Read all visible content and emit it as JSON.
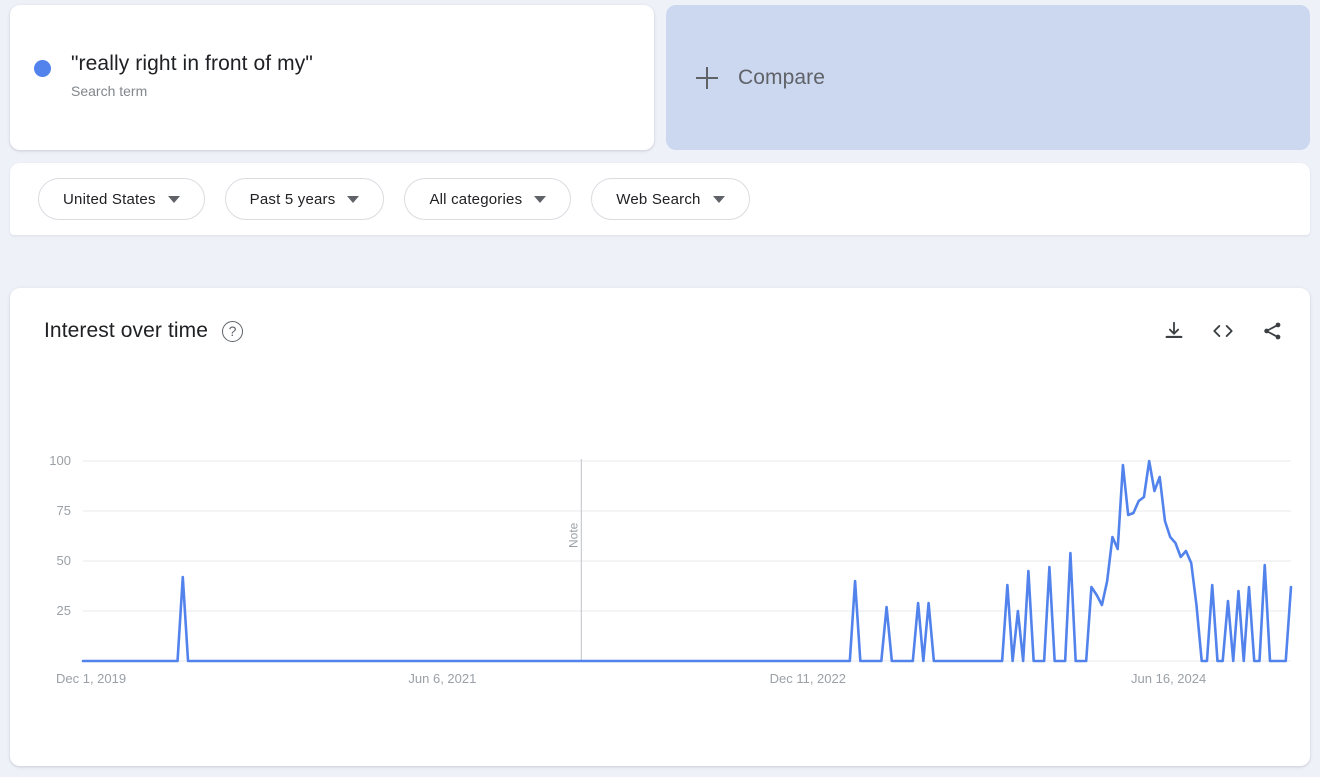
{
  "search_term": {
    "title": "\"really right in front of my\"",
    "subtitle": "Search term",
    "dot_color": "#5283ec"
  },
  "compare": {
    "label": "Compare",
    "icon": "plus-icon"
  },
  "filters": [
    {
      "label": "United States",
      "name": "location"
    },
    {
      "label": "Past 5 years",
      "name": "time-range"
    },
    {
      "label": "All categories",
      "name": "category"
    },
    {
      "label": "Web Search",
      "name": "search-type"
    }
  ],
  "chart_card": {
    "title": "Interest over time",
    "help_icon": "?",
    "actions": [
      {
        "name": "download-csv-icon",
        "label": "Download"
      },
      {
        "name": "embed-code-icon",
        "label": "Embed"
      },
      {
        "name": "share-icon",
        "label": "Share"
      }
    ]
  },
  "chart_data": {
    "type": "line",
    "title": "Interest over time",
    "xlabel": "",
    "ylabel": "",
    "ylim": [
      0,
      100
    ],
    "yticks": [
      100,
      75,
      50,
      25
    ],
    "xticks": [
      "Dec 1, 2019",
      "Jun 6, 2021",
      "Dec 11, 2022",
      "Jun 16, 2024"
    ],
    "xtick_positions": [
      0,
      0.2975,
      0.6,
      0.8987
    ],
    "grid": true,
    "legend": "hidden",
    "series_color": "#5283ec",
    "annotations": [
      {
        "label": "Note",
        "x_fraction": 0.4125,
        "orientation": "vertical"
      }
    ],
    "series": [
      {
        "name": "\"really right in front of my\"",
        "values": [
          0,
          0,
          0,
          0,
          0,
          0,
          0,
          0,
          0,
          0,
          0,
          0,
          0,
          0,
          0,
          0,
          0,
          0,
          0,
          42,
          0,
          0,
          0,
          0,
          0,
          0,
          0,
          0,
          0,
          0,
          0,
          0,
          0,
          0,
          0,
          0,
          0,
          0,
          0,
          0,
          0,
          0,
          0,
          0,
          0,
          0,
          0,
          0,
          0,
          0,
          0,
          0,
          0,
          0,
          0,
          0,
          0,
          0,
          0,
          0,
          0,
          0,
          0,
          0,
          0,
          0,
          0,
          0,
          0,
          0,
          0,
          0,
          0,
          0,
          0,
          0,
          0,
          0,
          0,
          0,
          0,
          0,
          0,
          0,
          0,
          0,
          0,
          0,
          0,
          0,
          0,
          0,
          0,
          0,
          0,
          0,
          0,
          0,
          0,
          0,
          0,
          0,
          0,
          0,
          0,
          0,
          0,
          0,
          0,
          0,
          0,
          0,
          0,
          0,
          0,
          0,
          0,
          0,
          0,
          0,
          0,
          0,
          0,
          0,
          0,
          0,
          0,
          0,
          0,
          0,
          0,
          0,
          0,
          0,
          0,
          0,
          0,
          0,
          0,
          0,
          0,
          0,
          0,
          0,
          0,
          0,
          0,
          40,
          0,
          0,
          0,
          0,
          0,
          27,
          0,
          0,
          0,
          0,
          0,
          29,
          0,
          29,
          0,
          0,
          0,
          0,
          0,
          0,
          0,
          0,
          0,
          0,
          0,
          0,
          0,
          0,
          38,
          0,
          25,
          0,
          45,
          0,
          0,
          0,
          47,
          0,
          0,
          0,
          54,
          0,
          0,
          0,
          37,
          33,
          28,
          40,
          62,
          56,
          98,
          73,
          74,
          80,
          82,
          100,
          85,
          92,
          70,
          62,
          59,
          52,
          55,
          49,
          28,
          0,
          0,
          38,
          0,
          0,
          30,
          0,
          35,
          0,
          37,
          0,
          0,
          48,
          0,
          0,
          0,
          0,
          37
        ]
      }
    ]
  }
}
